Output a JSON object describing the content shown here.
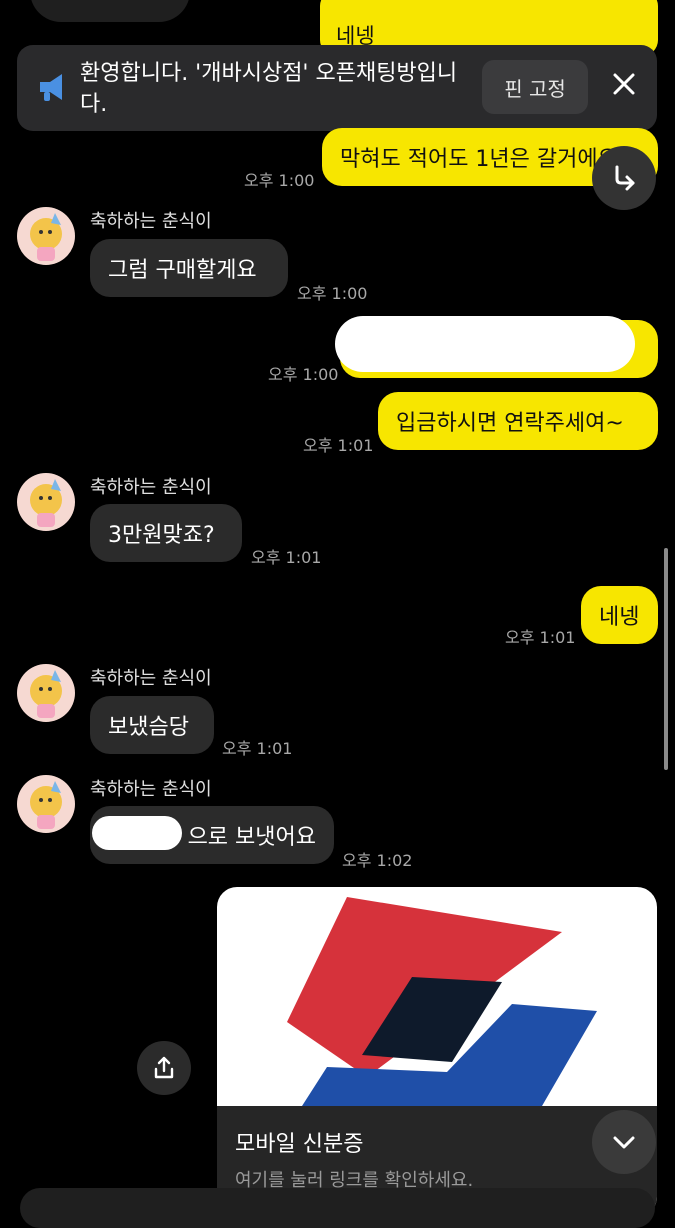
{
  "header": {
    "top_reply_text": "네넹"
  },
  "notice": {
    "text": "환영합니다. '개바시상점' 오픈채팅방입니다.",
    "pin_label": "핀 고정"
  },
  "messages": {
    "m1": {
      "text": "막혀도 적어도 1년은 갈거에요",
      "time": "오후 1:00"
    },
    "m2": {
      "name": "축하하는 춘식이",
      "text": "그럼 구매할게요",
      "time": "오후 1:00"
    },
    "m3": {
      "time": "오후 1:00"
    },
    "m4": {
      "text": "입금하시면 연락주세여~",
      "time": "오후 1:01"
    },
    "m5": {
      "name": "축하하는 춘식이",
      "text": "3만원맞죠?",
      "time": "오후 1:01"
    },
    "m6": {
      "text": "네넹",
      "time": "오후 1:01"
    },
    "m7": {
      "name": "축하하는 춘식이",
      "text": "보냈슴당",
      "time": "오후 1:01"
    },
    "m8": {
      "name": "축하하는 춘식이",
      "text": "으로 보냇어요",
      "time": "오후 1:02"
    }
  },
  "link_card": {
    "title": "모바일 신분증",
    "subtitle": "여기를 눌러 링크를 확인하세요."
  },
  "icons": {
    "notice": "megaphone-icon",
    "close": "close-icon",
    "reply": "reply-arrow-icon",
    "share": "share-icon",
    "expand": "chevron-down-icon"
  },
  "colors": {
    "my_bubble": "#f7e600",
    "other_bubble": "#2b2b2b",
    "background": "#000000",
    "logo_red": "#d6323b",
    "logo_navy": "#0e1a2b",
    "logo_blue": "#1f4fa8"
  }
}
